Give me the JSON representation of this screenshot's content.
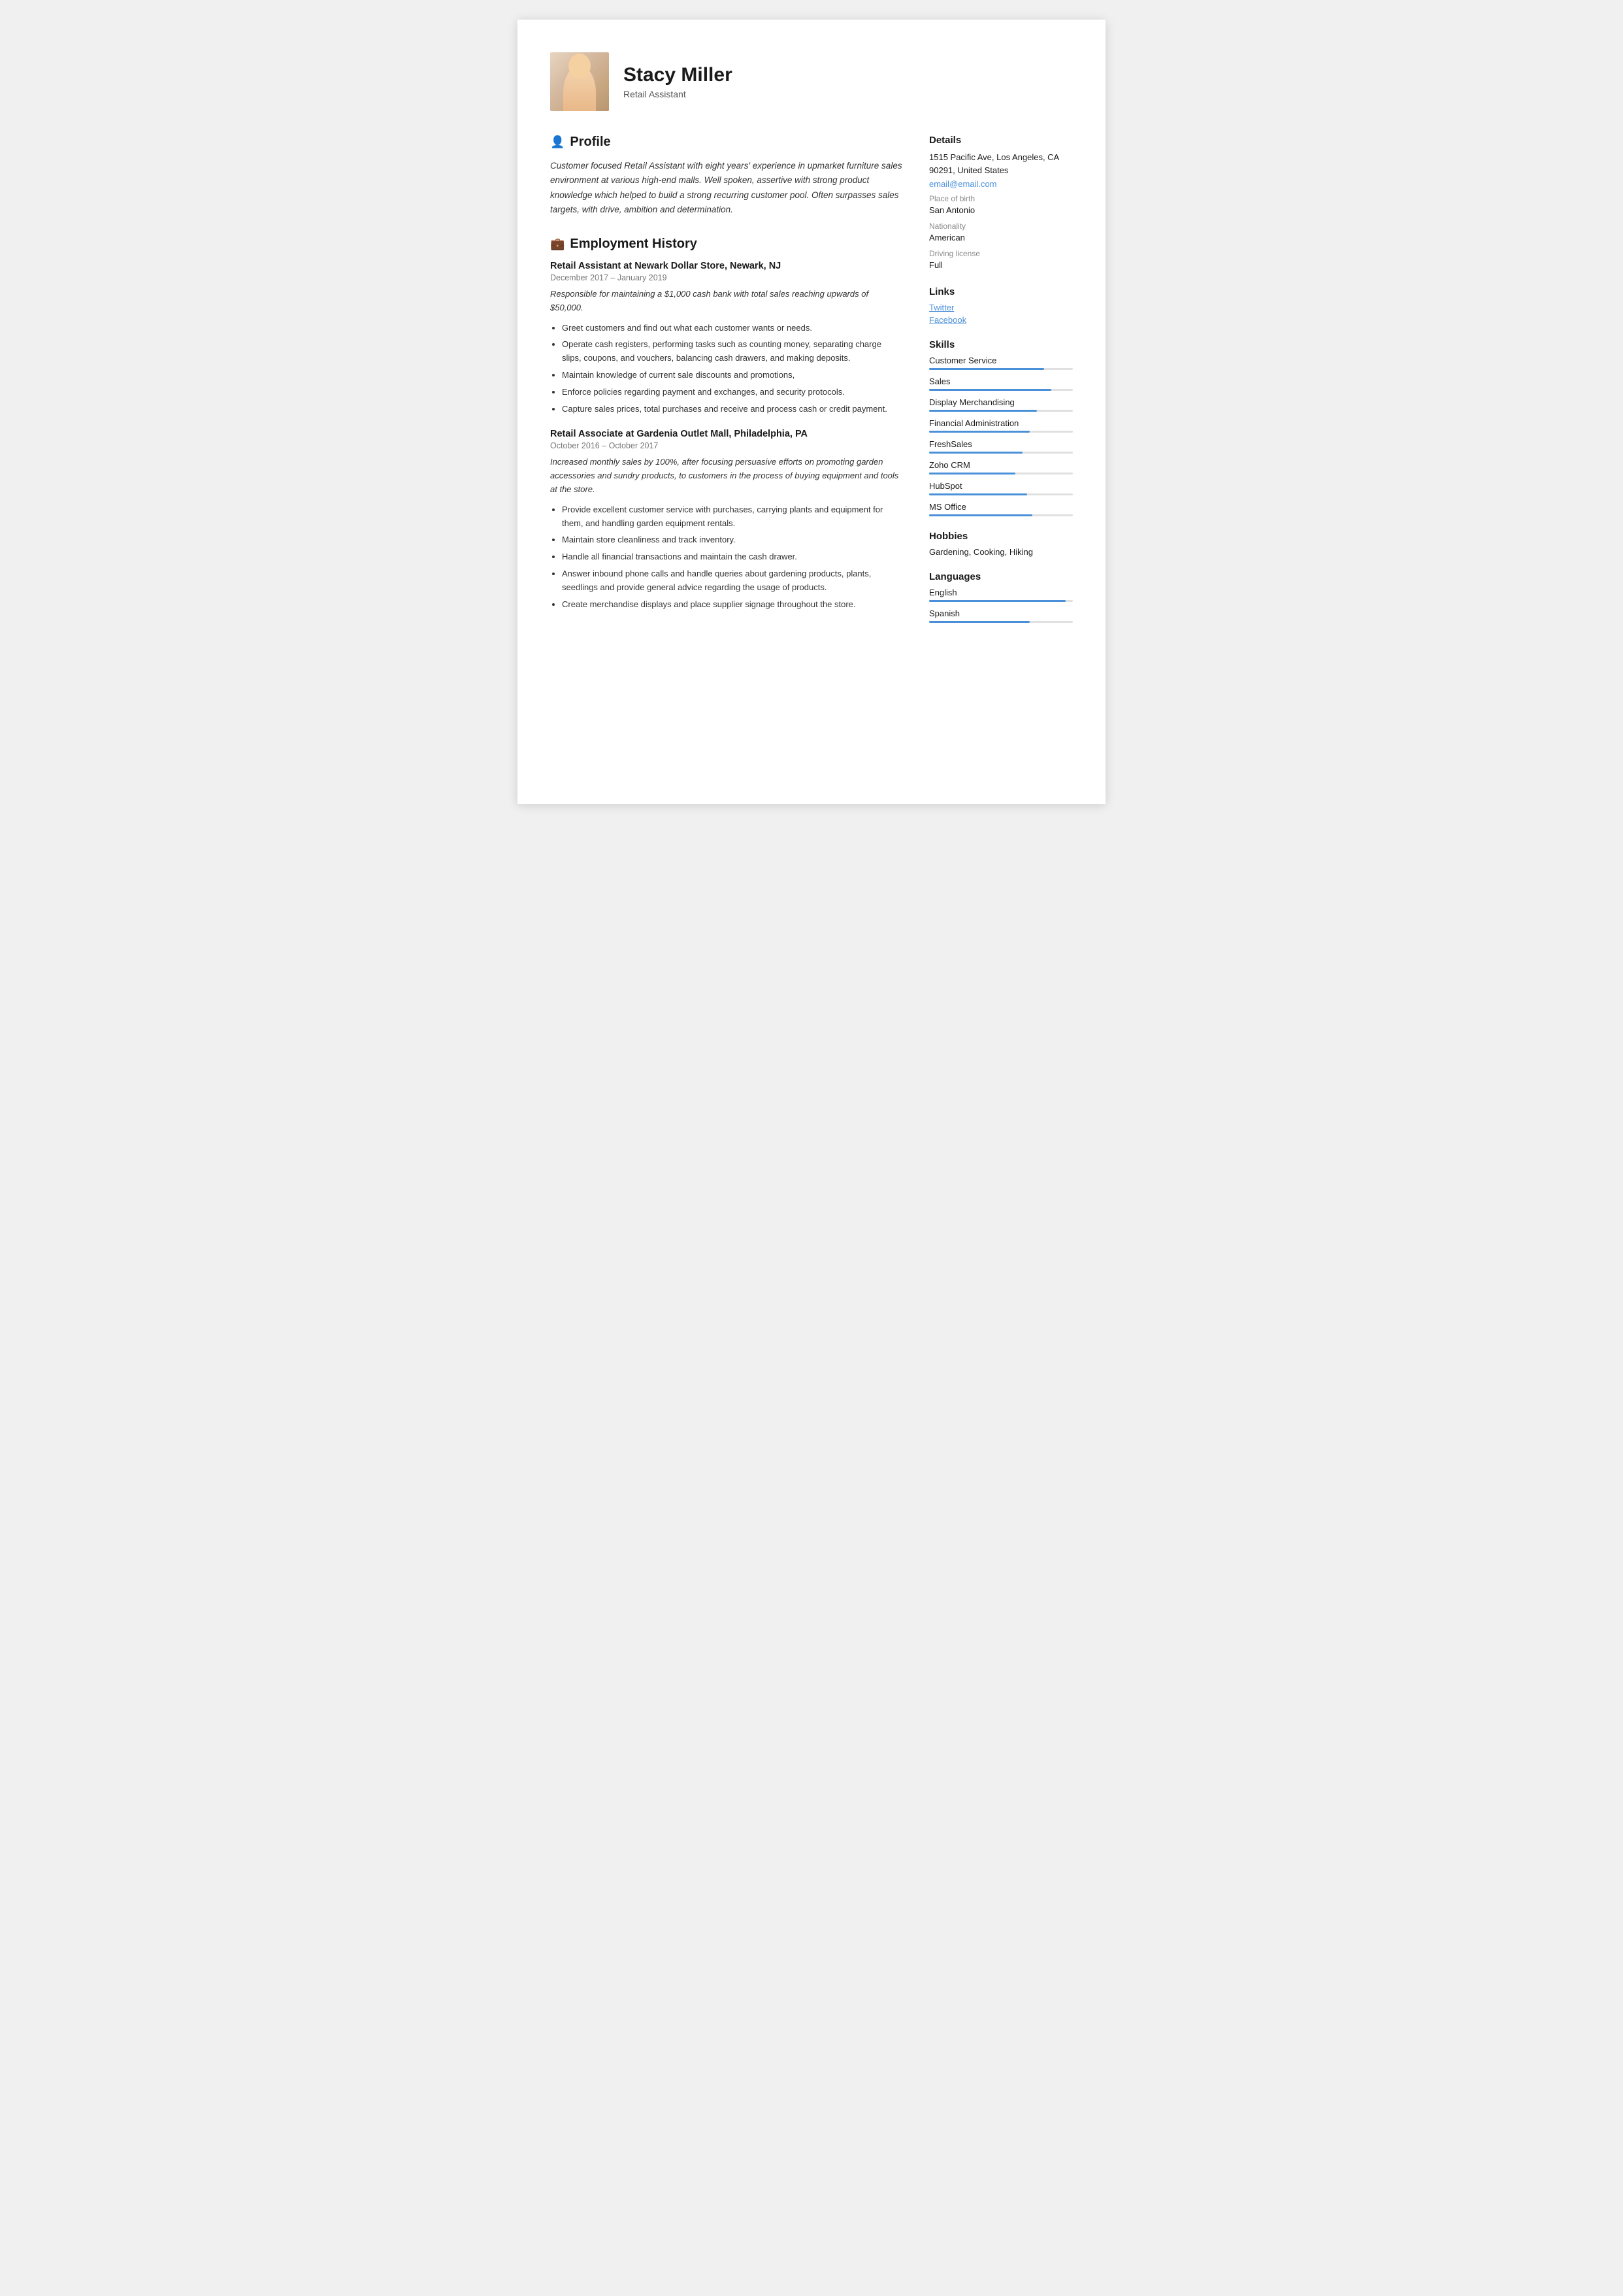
{
  "header": {
    "name": "Stacy Miller",
    "subtitle": "Retail Assistant"
  },
  "profile": {
    "section_title": "Profile",
    "text": "Customer focused Retail Assistant with eight years' experience in upmarket furniture sales environment at various high-end malls. Well spoken, assertive with strong product knowledge which helped to build a strong recurring customer pool. Often surpasses sales targets, with drive, ambition and determination."
  },
  "employment": {
    "section_title": "Employment History",
    "jobs": [
      {
        "title": "Retail Assistant at Newark Dollar Store, Newark, NJ",
        "dates": "December 2017  –  January 2019",
        "summary": "Responsible for maintaining a $1,000 cash bank with total sales reaching upwards of $50,000.",
        "bullets": [
          "Greet customers and find out what each customer wants or needs.",
          "Operate cash registers, performing tasks such as counting money, separating charge slips, coupons, and vouchers, balancing cash drawers, and making deposits.",
          "Maintain knowledge of current sale discounts and promotions,",
          "Enforce policies regarding payment and exchanges, and security protocols.",
          "Capture sales prices, total purchases and receive and process cash or credit payment."
        ]
      },
      {
        "title": "Retail Associate at Gardenia Outlet Mall, Philadelphia, PA",
        "dates": "October 2016  –  October 2017",
        "summary": "Increased monthly sales by 100%, after focusing persuasive efforts on promoting garden accessories and sundry products, to customers in the process of buying equipment and tools at the store.",
        "bullets": [
          "Provide excellent customer service with purchases, carrying plants and equipment for them, and handling garden equipment rentals.",
          "Maintain store cleanliness and track inventory.",
          "Handle all financial transactions and maintain the cash drawer.",
          "Answer inbound phone calls and handle queries about gardening products, plants, seedlings and provide general advice regarding the usage of products.",
          "Create merchandise displays and place supplier signage throughout the store."
        ]
      }
    ]
  },
  "details": {
    "section_title": "Details",
    "address": "1515 Pacific Ave, Los Angeles, CA 90291, United States",
    "email": "email@email.com",
    "place_of_birth_label": "Place of birth",
    "place_of_birth": "San Antonio",
    "nationality_label": "Nationality",
    "nationality": "American",
    "driving_license_label": "Driving license",
    "driving_license": "Full"
  },
  "links": {
    "section_title": "Links",
    "items": [
      {
        "label": "Twitter"
      },
      {
        "label": "Facebook"
      }
    ]
  },
  "skills": {
    "section_title": "Skills",
    "items": [
      {
        "name": "Customer Service",
        "pct": 80
      },
      {
        "name": "Sales",
        "pct": 85
      },
      {
        "name": "Display Merchandising",
        "pct": 75
      },
      {
        "name": "Financial Administration",
        "pct": 70
      },
      {
        "name": "FreshSales",
        "pct": 65
      },
      {
        "name": "Zoho CRM",
        "pct": 60
      },
      {
        "name": "HubSpot",
        "pct": 68
      },
      {
        "name": "MS Office",
        "pct": 72
      }
    ]
  },
  "hobbies": {
    "section_title": "Hobbies",
    "text": "Gardening, Cooking, Hiking"
  },
  "languages": {
    "section_title": "Languages",
    "items": [
      {
        "name": "English",
        "pct": 95
      },
      {
        "name": "Spanish",
        "pct": 70
      }
    ]
  }
}
